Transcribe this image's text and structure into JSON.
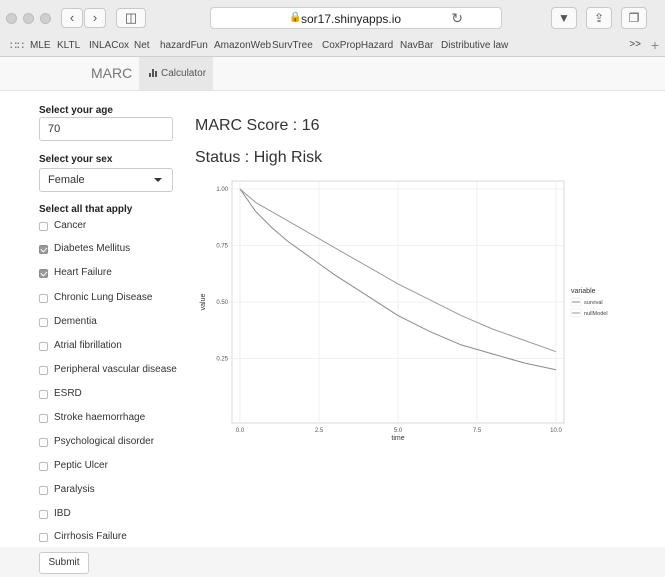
{
  "browser": {
    "url": "sor17.shinyapps.io",
    "bookmarks": [
      "MLE",
      "KLTL",
      "INLACox",
      "Net",
      "hazardFun",
      "AmazonWeb",
      "SurvTree",
      "CoxPropHazard",
      "NavBar",
      "Distributive law"
    ],
    "more": ">>"
  },
  "navbar": {
    "brand": "MARC",
    "tab_label": "Calculator"
  },
  "sidebar": {
    "age_label": "Select your age",
    "age_value": "70",
    "sex_label": "Select your sex",
    "sex_value": "Female",
    "conditions_label": "Select all that apply",
    "conditions": [
      {
        "label": "Cancer",
        "checked": false
      },
      {
        "label": "Diabetes Mellitus",
        "checked": true
      },
      {
        "label": "Heart Failure",
        "checked": true
      },
      {
        "label": "Chronic Lung Disease",
        "checked": false
      },
      {
        "label": "Dementia",
        "checked": false
      },
      {
        "label": "Atrial fibrillation",
        "checked": false
      },
      {
        "label": "Peripheral vascular disease",
        "checked": false
      },
      {
        "label": "ESRD",
        "checked": false
      },
      {
        "label": "Stroke haemorrhage",
        "checked": false
      },
      {
        "label": "Psychological disorder",
        "checked": false
      },
      {
        "label": "Peptic Ulcer",
        "checked": false
      },
      {
        "label": "Paralysis",
        "checked": false
      },
      {
        "label": "IBD",
        "checked": false
      },
      {
        "label": "Cirrhosis Failure",
        "checked": false
      }
    ],
    "submit_label": "Submit"
  },
  "main": {
    "score_text": "MARC Score : 16",
    "status_text": "Status : High Risk"
  },
  "chart_data": {
    "type": "line",
    "xlabel": "time",
    "ylabel": "value",
    "xlim": [
      0,
      10
    ],
    "ylim": [
      0,
      1
    ],
    "xticks": [
      "0.0",
      "2.5",
      "5.0",
      "7.5",
      "10.0"
    ],
    "yticks": [
      "0.25",
      "0.50",
      "0.75",
      "1.00"
    ],
    "legend_title": "variable",
    "legend_position": "right",
    "grid": true,
    "series": [
      {
        "name": "survival",
        "x": [
          0,
          0.5,
          1,
          1.5,
          2,
          2.5,
          3,
          4,
          5,
          6,
          7,
          8,
          9,
          10
        ],
        "values": [
          1.0,
          0.9,
          0.83,
          0.77,
          0.72,
          0.67,
          0.62,
          0.53,
          0.44,
          0.37,
          0.31,
          0.27,
          0.23,
          0.2
        ]
      },
      {
        "name": "nullModel",
        "x": [
          0,
          0.5,
          1,
          1.5,
          2,
          2.5,
          3,
          4,
          5,
          6,
          7,
          8,
          9,
          10
        ],
        "values": [
          1.0,
          0.94,
          0.9,
          0.86,
          0.82,
          0.78,
          0.74,
          0.66,
          0.58,
          0.51,
          0.44,
          0.38,
          0.33,
          0.28
        ]
      }
    ]
  }
}
